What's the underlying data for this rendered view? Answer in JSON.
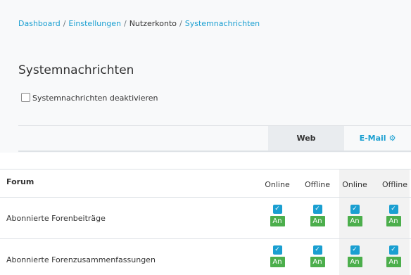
{
  "breadcrumb": {
    "items": [
      "Dashboard",
      "Einstellungen",
      "Nutzerkonto",
      "Systemnachrichten"
    ],
    "separator": "/"
  },
  "page_title": "Systemnachrichten",
  "deactivate": {
    "label": "Systemnachrichten deaktivieren",
    "checked": false
  },
  "tabs": {
    "web": "Web",
    "email": "E-Mail",
    "email_icon": "gear-icon"
  },
  "table": {
    "header": "Forum",
    "columns": [
      "Online",
      "Offline",
      "Online",
      "Offline"
    ],
    "rows": [
      {
        "label": "Abonnierte Forenbeiträge",
        "cells": [
          "An",
          "An",
          "An",
          "An"
        ]
      },
      {
        "label": "Abonnierte Forenzusammenfassungen",
        "cells": [
          "An",
          "An",
          "An",
          "An"
        ]
      }
    ]
  },
  "colors": {
    "link": "#1a9fd1",
    "checkbox": "#1a9fd1",
    "badge_on": "#4cae4c"
  },
  "icons": {
    "check": "check-icon",
    "gear": "gear-icon"
  }
}
